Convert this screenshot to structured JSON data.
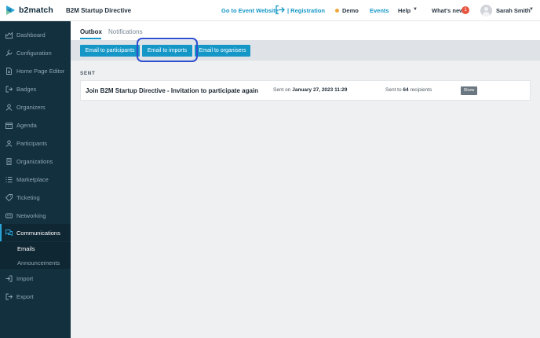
{
  "brand": {
    "name": "b2match"
  },
  "header": {
    "event_title": "B2M Startup Directive",
    "go_to_website": "Go to Event Website",
    "registration": "| Registration",
    "demo": "Demo",
    "events": "Events",
    "help": "Help",
    "whats_new": "What's new",
    "whats_new_count": "1",
    "user_name": "Sarah Smith"
  },
  "sidebar": {
    "items": [
      {
        "label": "Dashboard",
        "icon": "dashboard-icon"
      },
      {
        "label": "Configuration",
        "icon": "wrench-icon"
      },
      {
        "label": "Home Page Editor",
        "icon": "page-icon"
      },
      {
        "label": "Badges",
        "icon": "badge-icon"
      },
      {
        "label": "Organizers",
        "icon": "people-icon"
      },
      {
        "label": "Agenda",
        "icon": "calendar-icon"
      },
      {
        "label": "Participants",
        "icon": "participants-icon"
      },
      {
        "label": "Organizations",
        "icon": "building-icon"
      },
      {
        "label": "Marketplace",
        "icon": "list-icon"
      },
      {
        "label": "Ticketing",
        "icon": "tag-icon"
      },
      {
        "label": "Networking",
        "icon": "networking-icon"
      },
      {
        "label": "Communications",
        "icon": "chat-icon"
      },
      {
        "label": "Import",
        "icon": "import-icon"
      },
      {
        "label": "Export",
        "icon": "export-icon"
      }
    ],
    "sub_items": [
      "Emails",
      "Announcements"
    ]
  },
  "tabs": [
    "Outbox",
    "Notifications"
  ],
  "toolbar": {
    "email_participants": "Email to participants",
    "email_imports": "Email to imports",
    "email_organisers": "Email to organisers"
  },
  "section_label": "SENT",
  "emails": [
    {
      "subject": "Join B2M Startup Directive - Invitation to participate again",
      "sent_prefix": "Sent on",
      "sent_date": "January 27, 2023 11:29",
      "rcpt_prefix": "Sent to",
      "rcpt_count": "64",
      "rcpt_suffix": "recipients",
      "show_label": "Show"
    }
  ],
  "colors": {
    "accent": "#1497c7",
    "sidebar": "#13303f",
    "highlight": "#2f4fd0"
  }
}
